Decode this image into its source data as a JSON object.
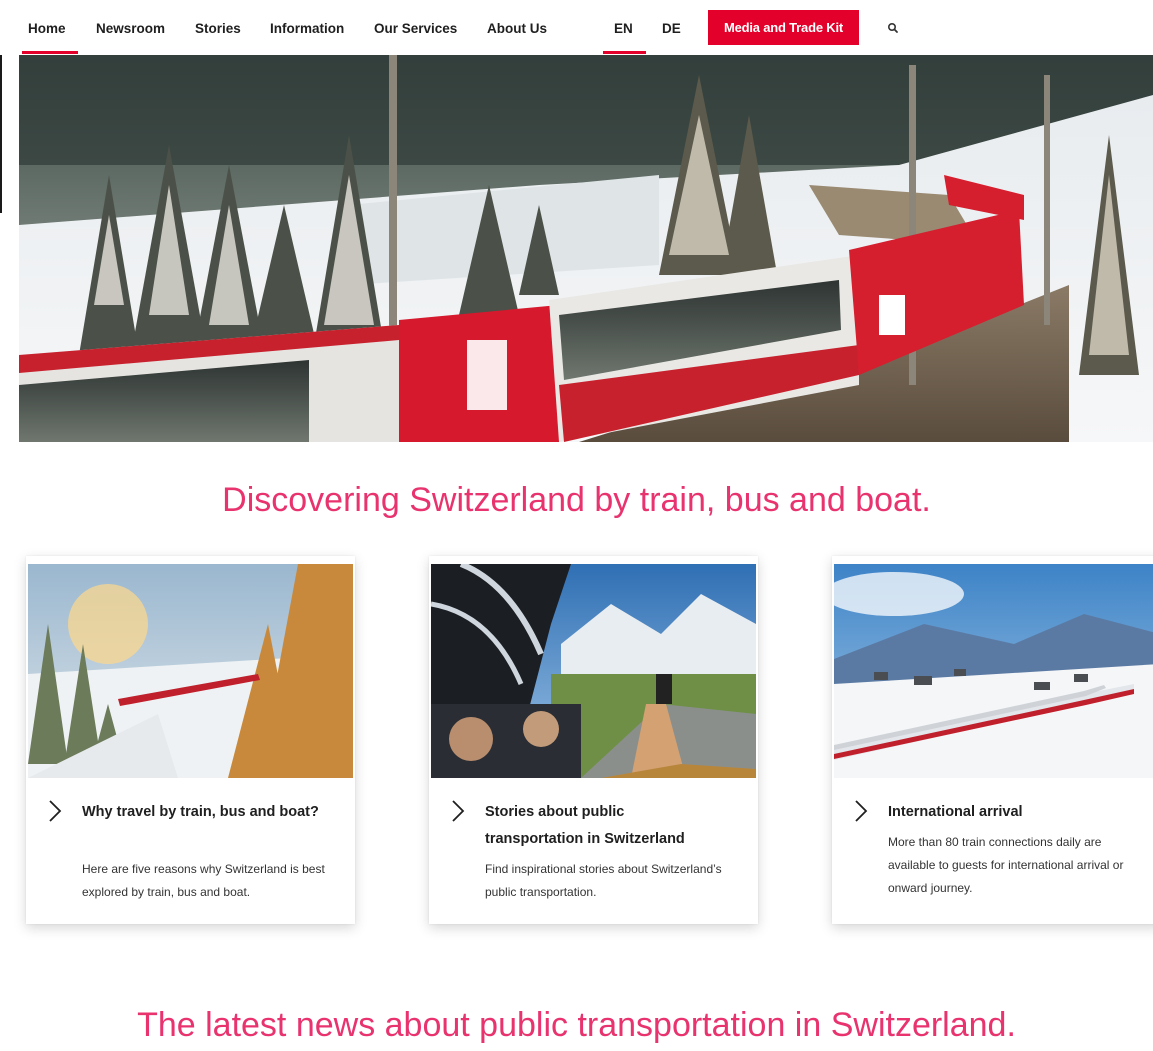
{
  "nav": {
    "items": [
      {
        "label": "Home",
        "active": true
      },
      {
        "label": "Newsroom"
      },
      {
        "label": "Stories"
      },
      {
        "label": "Information"
      },
      {
        "label": "Our Services"
      },
      {
        "label": "About Us"
      }
    ],
    "languages": [
      {
        "label": "EN",
        "active": true
      },
      {
        "label": "DE"
      }
    ],
    "media_button": "Media and Trade Kit",
    "search_icon": "search-icon"
  },
  "hero": {
    "image": "red-and-white-panoramic-train-crossing-viaduct-in-snowy-forest"
  },
  "headings": {
    "discover": "Discovering Switzerland by train, bus and boat.",
    "news": "The latest news about public transportation in Switzerland."
  },
  "cards": [
    {
      "title": "Why travel by train, bus and boat?",
      "description": "Here are five reasons why Switzerland is best explored by train, bus and boat.",
      "icon": "chevron-right-icon"
    },
    {
      "title": "Stories about public transportation in Switzerland",
      "description": "Find inspirational stories about Switzerland’s public transportation.",
      "icon": "chevron-right-icon"
    },
    {
      "title": "International arrival",
      "description": "More than 80 train connections daily are available to guests for international arrival or onward journey.",
      "icon": "chevron-right-icon"
    }
  ],
  "colors": {
    "accent_red": "#e3002a",
    "heading_pink": "#e8336f"
  }
}
